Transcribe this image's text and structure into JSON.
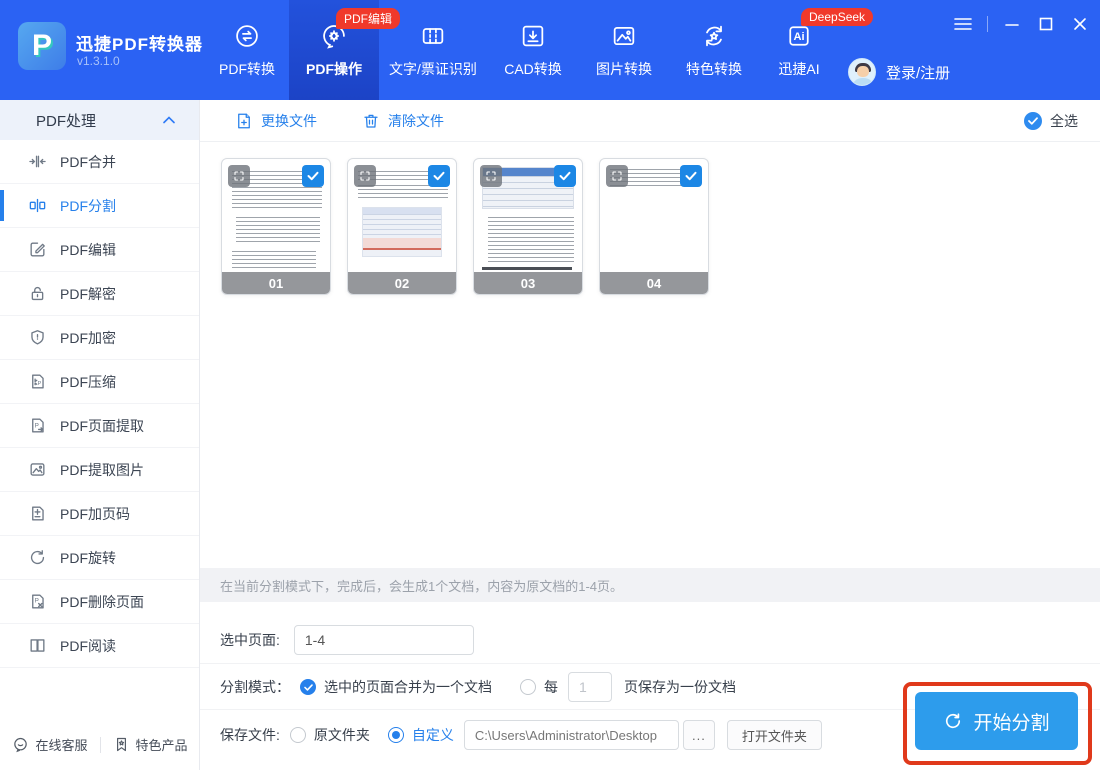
{
  "window": {
    "app_title": "迅捷PDF转换器",
    "version": "v1.3.1.0"
  },
  "header": {
    "nav": [
      {
        "label": "PDF转换",
        "active": false
      },
      {
        "label": "PDF操作",
        "active": true,
        "badge": "PDF编辑"
      },
      {
        "label": "文字/票证识别",
        "active": false
      },
      {
        "label": "CAD转换",
        "active": false
      },
      {
        "label": "图片转换",
        "active": false
      },
      {
        "label": "特色转换",
        "active": false
      },
      {
        "label": "迅捷AI",
        "active": false,
        "badge": "DeepSeek"
      }
    ],
    "login_label": "登录/注册"
  },
  "sidebar": {
    "section_title": "PDF处理",
    "items": [
      {
        "label": "PDF合并",
        "active": false
      },
      {
        "label": "PDF分割",
        "active": true
      },
      {
        "label": "PDF编辑",
        "active": false
      },
      {
        "label": "PDF解密",
        "active": false
      },
      {
        "label": "PDF加密",
        "active": false
      },
      {
        "label": "PDF压缩",
        "active": false
      },
      {
        "label": "PDF页面提取",
        "active": false
      },
      {
        "label": "PDF提取图片",
        "active": false
      },
      {
        "label": "PDF加页码",
        "active": false
      },
      {
        "label": "PDF旋转",
        "active": false
      },
      {
        "label": "PDF删除页面",
        "active": false
      },
      {
        "label": "PDF阅读",
        "active": false
      }
    ],
    "footer": {
      "support_label": "在线客服",
      "products_label": "特色产品"
    }
  },
  "toolbar": {
    "replace_label": "更换文件",
    "clear_label": "清除文件",
    "select_all_label": "全选"
  },
  "thumbnails": [
    {
      "number": "01",
      "checked": true
    },
    {
      "number": "02",
      "checked": true
    },
    {
      "number": "03",
      "checked": true
    },
    {
      "number": "04",
      "checked": true
    }
  ],
  "status_text": "在当前分割模式下，完成后，会生成1个文档，内容为原文档的1-4页。",
  "form": {
    "pages_label": "选中页面:",
    "pages_value": "1-4",
    "mode_label": "分割模式：",
    "mode_option_merge": "选中的页面合并为一个文档",
    "mode_option_every_prefix": "每",
    "mode_every_value": "1",
    "mode_option_every_suffix": "页保存为一份文档",
    "save_label": "保存文件:",
    "save_option_original": "原文件夹",
    "save_option_custom": "自定义",
    "path_value": "C:\\Users\\Administrator\\Desktop",
    "browse_label": "...",
    "open_folder_label": "打开文件夹",
    "start_label": "开始分割"
  },
  "colors": {
    "header_blue": "#2B62F3",
    "active_nav_blue": "#1C43C6",
    "badge_red": "#F0392B",
    "accent_blue": "#2680EB",
    "start_button_blue": "#2D9CEC",
    "annotation_red": "#E0391B",
    "thumb_check_blue": "#1C87E5"
  }
}
